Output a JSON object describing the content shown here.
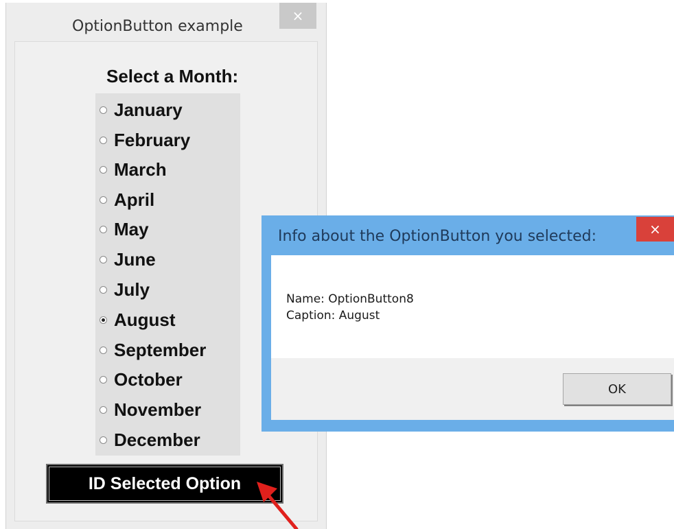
{
  "userform": {
    "title": "OptionButton example",
    "close_glyph": "×",
    "heading": "Select a Month:",
    "options": [
      {
        "label": "January",
        "checked": false
      },
      {
        "label": "February",
        "checked": false
      },
      {
        "label": "March",
        "checked": false
      },
      {
        "label": "April",
        "checked": false
      },
      {
        "label": "May",
        "checked": false
      },
      {
        "label": "June",
        "checked": false
      },
      {
        "label": "July",
        "checked": false
      },
      {
        "label": "August",
        "checked": true
      },
      {
        "label": "September",
        "checked": false
      },
      {
        "label": "October",
        "checked": false
      },
      {
        "label": "November",
        "checked": false
      },
      {
        "label": "December",
        "checked": false
      }
    ],
    "button_label": "ID Selected Option"
  },
  "msgbox": {
    "title": "Info about the OptionButton you selected:",
    "close_glyph": "×",
    "line1": "Name: OptionButton8",
    "line2": "Caption: August",
    "ok_label": "OK"
  },
  "colors": {
    "msgbox_frame": "#6aaee8",
    "close_red": "#d9413a",
    "arrow_red": "#e0201c"
  },
  "icons": {
    "userform_close": "close-icon",
    "msgbox_close": "close-icon",
    "annotation": "red-arrow-icon"
  }
}
